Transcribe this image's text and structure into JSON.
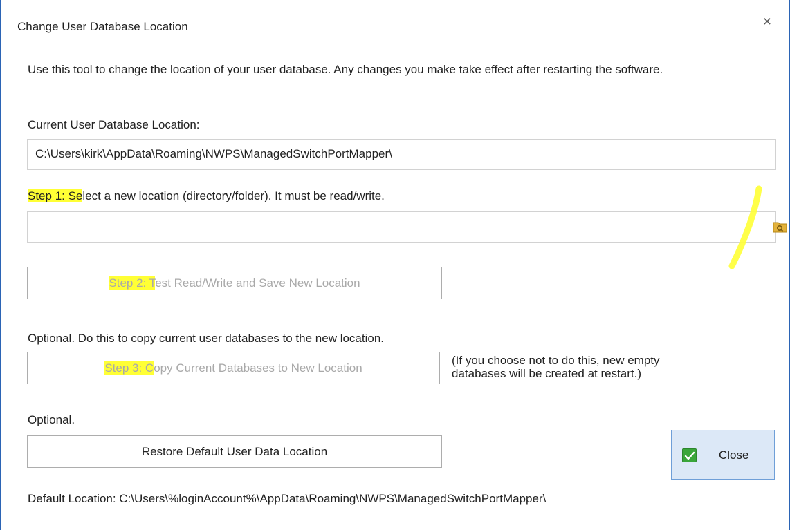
{
  "dialog": {
    "title": "Change User Database Location",
    "close_glyph": "×"
  },
  "description": "Use this tool to change the location of your user database. Any changes you make take effect after restarting the software.",
  "current": {
    "label": "Current User Database Location:",
    "value": "C:\\Users\\kirk\\AppData\\Roaming\\NWPS\\ManagedSwitchPortMapper\\"
  },
  "step1": {
    "label_highlight": "Step 1: Se",
    "label_rest": "lect a new location (directory/folder). It must be read/write.",
    "input_value": "",
    "input_placeholder": "",
    "browse_icon": "folder-search-icon"
  },
  "step2": {
    "label_highlight": "Step 2: T",
    "label_rest": "est Read/Write and Save New Location"
  },
  "optional1": {
    "label": "Optional. Do this to copy current user databases to the new location."
  },
  "step3": {
    "label_highlight": "Step 3: C",
    "label_rest": "opy Current Databases to New Location",
    "note_line1": "(If you choose not to do this, new empty",
    "note_line2": "databases will be created at restart.)"
  },
  "optional2": {
    "label": "Optional."
  },
  "restore": {
    "label": "Restore Default User Data Location"
  },
  "close_button": {
    "label": "Close",
    "icon": "check-icon"
  },
  "default_location": {
    "text": "Default Location: C:\\Users\\%loginAccount%\\AppData\\Roaming\\NWPS\\ManagedSwitchPortMapper\\"
  },
  "colors": {
    "highlight": "#ffff35",
    "border_accent": "#2b64b5",
    "close_bg": "#dce8f7",
    "check_green": "#3aa63a",
    "disabled_text": "#a9a9a9"
  }
}
